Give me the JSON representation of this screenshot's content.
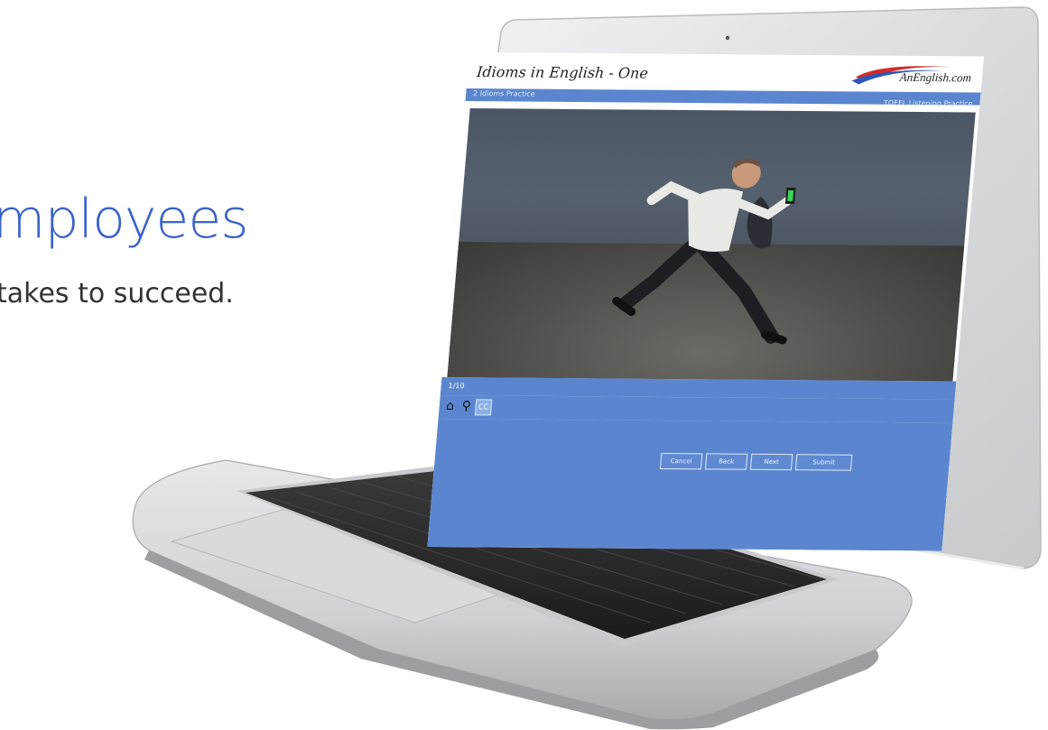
{
  "hero": {
    "title": "mployees",
    "subtitle": "takes to succeed."
  },
  "app": {
    "title": "Idioms in English - One",
    "logo_text": "AnEnglish.com",
    "subheader_left": "2 Idioms Practice",
    "subheader_right": "TOEFL Listening Practice",
    "strip_label": "1/10",
    "tools": {
      "home": "home-icon",
      "search": "search-icon",
      "box_label": "CC"
    },
    "nav_buttons": [
      "Cancel",
      "Back",
      "Next",
      "Submit"
    ]
  },
  "colors": {
    "hero_blue": "#3b63c9",
    "app_blue": "#5b86cf",
    "laptop_silver": "#cfd1d4"
  }
}
